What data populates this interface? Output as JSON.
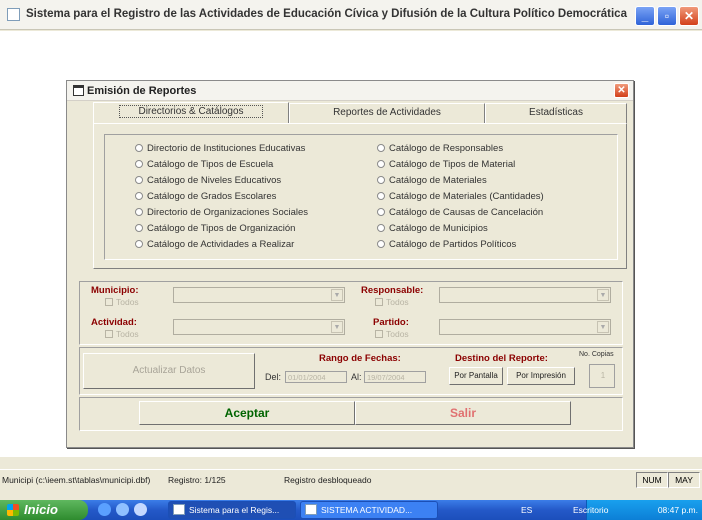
{
  "window": {
    "title": "Sistema para el Registro de las Actividades de Educación Cívica y Difusión de la Cultura Político Democrática",
    "minimize": "_",
    "maximize": "▫",
    "close": "✕"
  },
  "dialog": {
    "title": "Emisión de Reportes",
    "close": "✕",
    "tabs": [
      "Directorios & Catálogos",
      "Reportes de Actividades",
      "Estadísticas"
    ],
    "options_left": [
      "Directorio de Instituciones Educativas",
      "Catálogo de Tipos de Escuela",
      "Catálogo de Niveles Educativos",
      "Catálogo de Grados Escolares",
      "Directorio de Organizaciones Sociales",
      "Catálogo de Tipos de Organización",
      "Catálogo de Actividades a Realizar"
    ],
    "options_right": [
      "Catálogo de Responsables",
      "Catálogo de Tipos de Material",
      "Catálogo de Materiales",
      "Catálogo de Materiales (Cantidades)",
      "Catálogo de Causas de Cancelación",
      "Catálogo de Municipios",
      "Catálogo de Partidos Políticos"
    ],
    "filters": {
      "municipio_label": "Municipio:",
      "responsable_label": "Responsable:",
      "actividad_label": "Actividad:",
      "partido_label": "Partido:",
      "todos": "Todos"
    },
    "update_button": "Actualizar Datos",
    "date_range": {
      "label": "Rango de Fechas:",
      "del_label": "Del:",
      "del_value": "01/01/2004",
      "al_label": "Al:",
      "al_value": "19/07/2004"
    },
    "destination": {
      "label": "Destino del Reporte:",
      "copies_label": "No. Copias",
      "screen_button": "Por Pantalla",
      "print_button": "Por Impresión",
      "copies_value": "1"
    },
    "accept_button": "Aceptar",
    "exit_button": "Salir"
  },
  "statusbar": {
    "path": "Municipi (c:\\ieem.st\\tablas\\municipi.dbf)",
    "record": "Registro: 1/125",
    "lock": "Registro desbloqueado",
    "num": "NUM",
    "may": "MAY"
  },
  "taskbar": {
    "start": "Inicio",
    "task1": "Sistema para el Regis...",
    "task2": "SISTEMA ACTIVIDAD...",
    "lang": "ES",
    "desktop": "Escritorio",
    "time": "08:47 p.m."
  },
  "colors": {
    "accent": "#2459c8",
    "label_red": "#8b0000",
    "accept_green": "#006400",
    "exit_red": "#e07070"
  }
}
